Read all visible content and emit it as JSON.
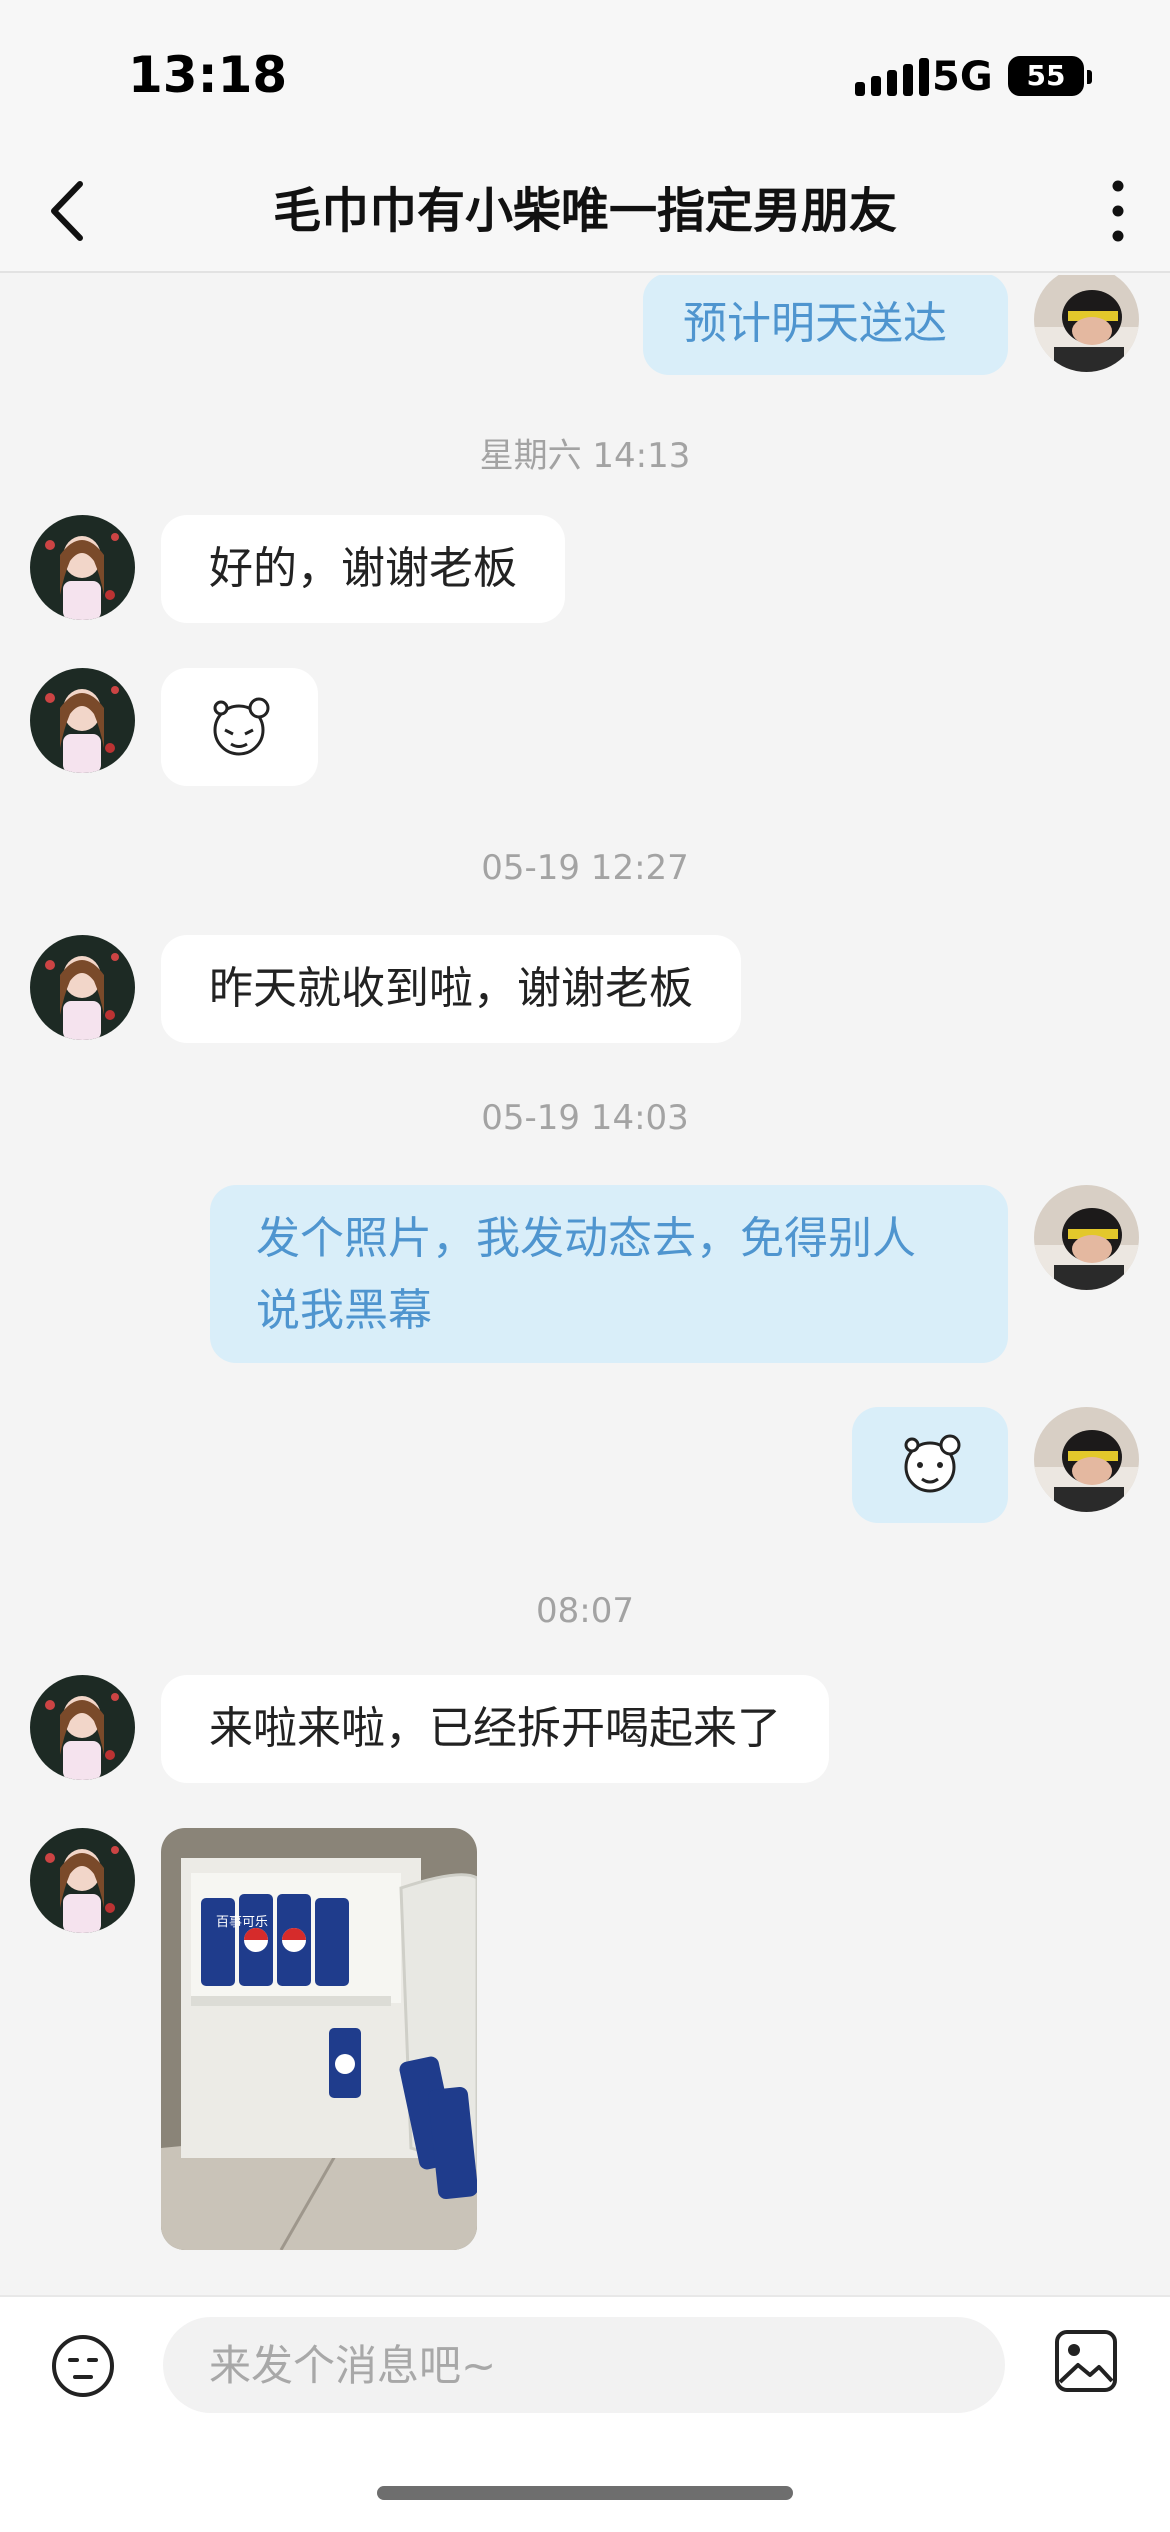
{
  "status_bar": {
    "time": "13:18",
    "network": "5G",
    "battery": "55"
  },
  "header": {
    "title": "毛巾巾有小柴唯一指定男朋友"
  },
  "messages": {
    "m1": "预计明天送达",
    "t1": "星期六 14:13",
    "m2": "好的，谢谢老板",
    "t2": "05-19 12:27",
    "m3": "昨天就收到啦，谢谢老板",
    "t3": "05-19 14:03",
    "m4_line1": "发个照片，我发动态去，免得别人",
    "m4_line2": "说我黑幕",
    "t4": "08:07",
    "m5": "来啦来啦，已经拆开喝起来了"
  },
  "photo": {
    "can_text": "百事可乐"
  },
  "input": {
    "placeholder": "来发个消息吧~"
  },
  "icons": [
    "back-arrow-icon",
    "more-dots-icon",
    "emoji-icon",
    "image-icon",
    "sticker-icon"
  ],
  "colors": {
    "outgoing_bubble": "#d9eef9",
    "outgoing_text": "#4f95cf",
    "incoming_bubble": "#ffffff",
    "background": "#f4f4f4"
  }
}
